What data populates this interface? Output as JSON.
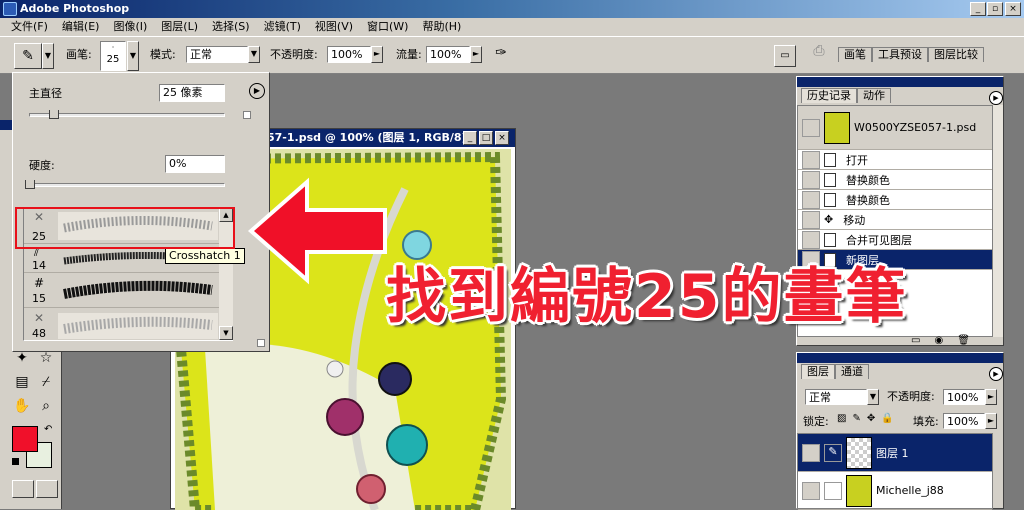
{
  "window": {
    "title": "Adobe Photoshop",
    "min": "_",
    "restore": "▫",
    "close": "×"
  },
  "menu": [
    "文件(F)",
    "编辑(E)",
    "图像(I)",
    "图层(L)",
    "选择(S)",
    "滤镜(T)",
    "视图(V)",
    "窗口(W)",
    "帮助(H)"
  ],
  "options": {
    "brush_label": "画笔:",
    "brush_size": "25",
    "mode_label": "模式:",
    "mode_value": "正常",
    "opacity_label": "不透明度:",
    "opacity_value": "100%",
    "flow_label": "流量:",
    "flow_value": "100%",
    "right_tabs": [
      "画笔",
      "工具预设",
      "图层比较"
    ]
  },
  "brush_popup": {
    "diameter_label": "主直径",
    "diameter_value": "25 像素",
    "hardness_label": "硬度:",
    "hardness_value": "0%",
    "presets": [
      {
        "size": "25",
        "tooltip": "Crosshatch 1"
      },
      {
        "size": "14"
      },
      {
        "size": "15"
      },
      {
        "size": "48"
      }
    ]
  },
  "document": {
    "title": "57-1.psd @ 100% (图层 1, RGB/8)"
  },
  "history": {
    "tabs": [
      "历史记录",
      "动作"
    ],
    "snapshot": "W0500YZSE057-1.psd",
    "items": [
      "打开",
      "替换颜色",
      "替换颜色",
      "移动",
      "合并可见图层",
      "新图层"
    ],
    "selected_index": 5
  },
  "layers": {
    "tabs": [
      "图层",
      "通道"
    ],
    "blend_mode": "正常",
    "opacity_label": "不透明度:",
    "opacity_value": "100%",
    "lock_label": "锁定:",
    "fill_label": "填充:",
    "fill_value": "100%",
    "items": [
      {
        "name": "图层 1",
        "selected": true
      },
      {
        "name": "Michelle_j88",
        "selected": false
      }
    ]
  },
  "annotation": "找到編號25的畫筆",
  "colors": {
    "accent": "#f02030",
    "titlebar": "#0a246a",
    "foreground": "#f0102a",
    "background": "#e8f0e0"
  }
}
